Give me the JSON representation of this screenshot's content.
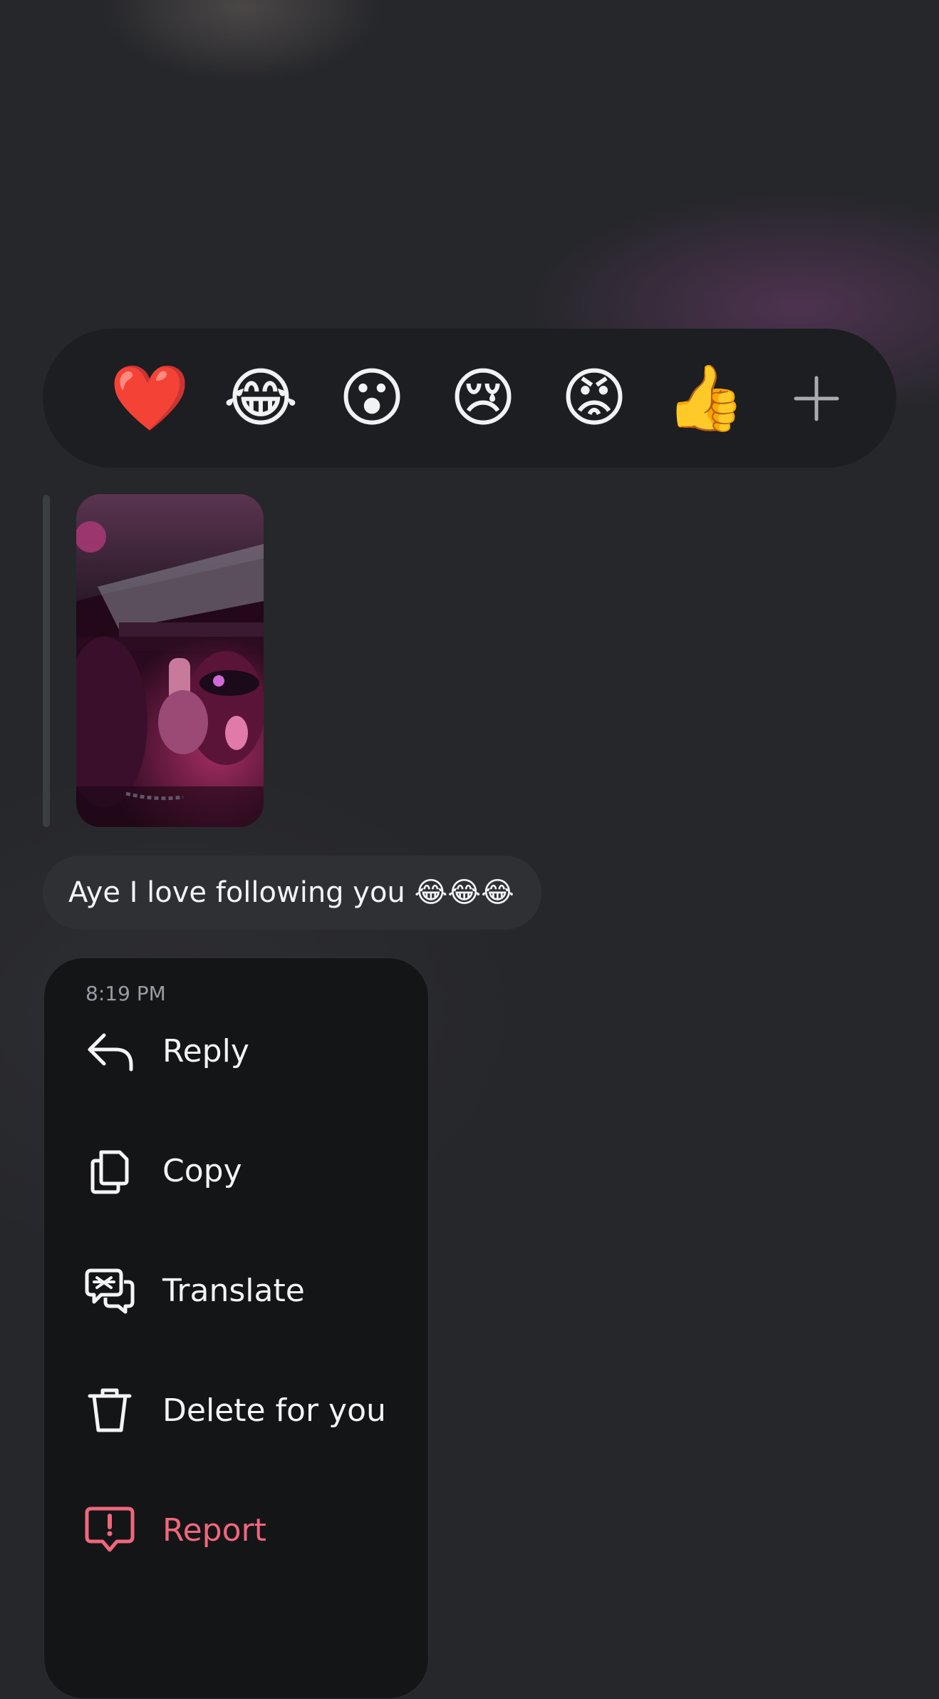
{
  "reactions": [
    {
      "emoji": "❤️",
      "name": "heart"
    },
    {
      "emoji": "😂",
      "name": "laughing"
    },
    {
      "emoji": "😮",
      "name": "surprised"
    },
    {
      "emoji": "😢",
      "name": "crying"
    },
    {
      "emoji": "😡",
      "name": "angry"
    },
    {
      "emoji": "👍",
      "name": "thumbs-up"
    }
  ],
  "more_reactions_icon": "plus-icon",
  "message": {
    "text": "Aye I love following you 😂😂😂",
    "attachment": "photo"
  },
  "menu": {
    "time": "8:19 PM",
    "items": [
      {
        "label": "Reply",
        "icon": "reply-icon"
      },
      {
        "label": "Copy",
        "icon": "copy-icon"
      },
      {
        "label": "Translate",
        "icon": "translate-icon"
      },
      {
        "label": "Delete for you",
        "icon": "trash-icon"
      },
      {
        "label": "Report",
        "icon": "report-icon"
      }
    ]
  },
  "colors": {
    "background": "#26272b",
    "menu_background": "#141517",
    "reaction_bar": "#1c1e21",
    "danger": "#f0677c"
  }
}
